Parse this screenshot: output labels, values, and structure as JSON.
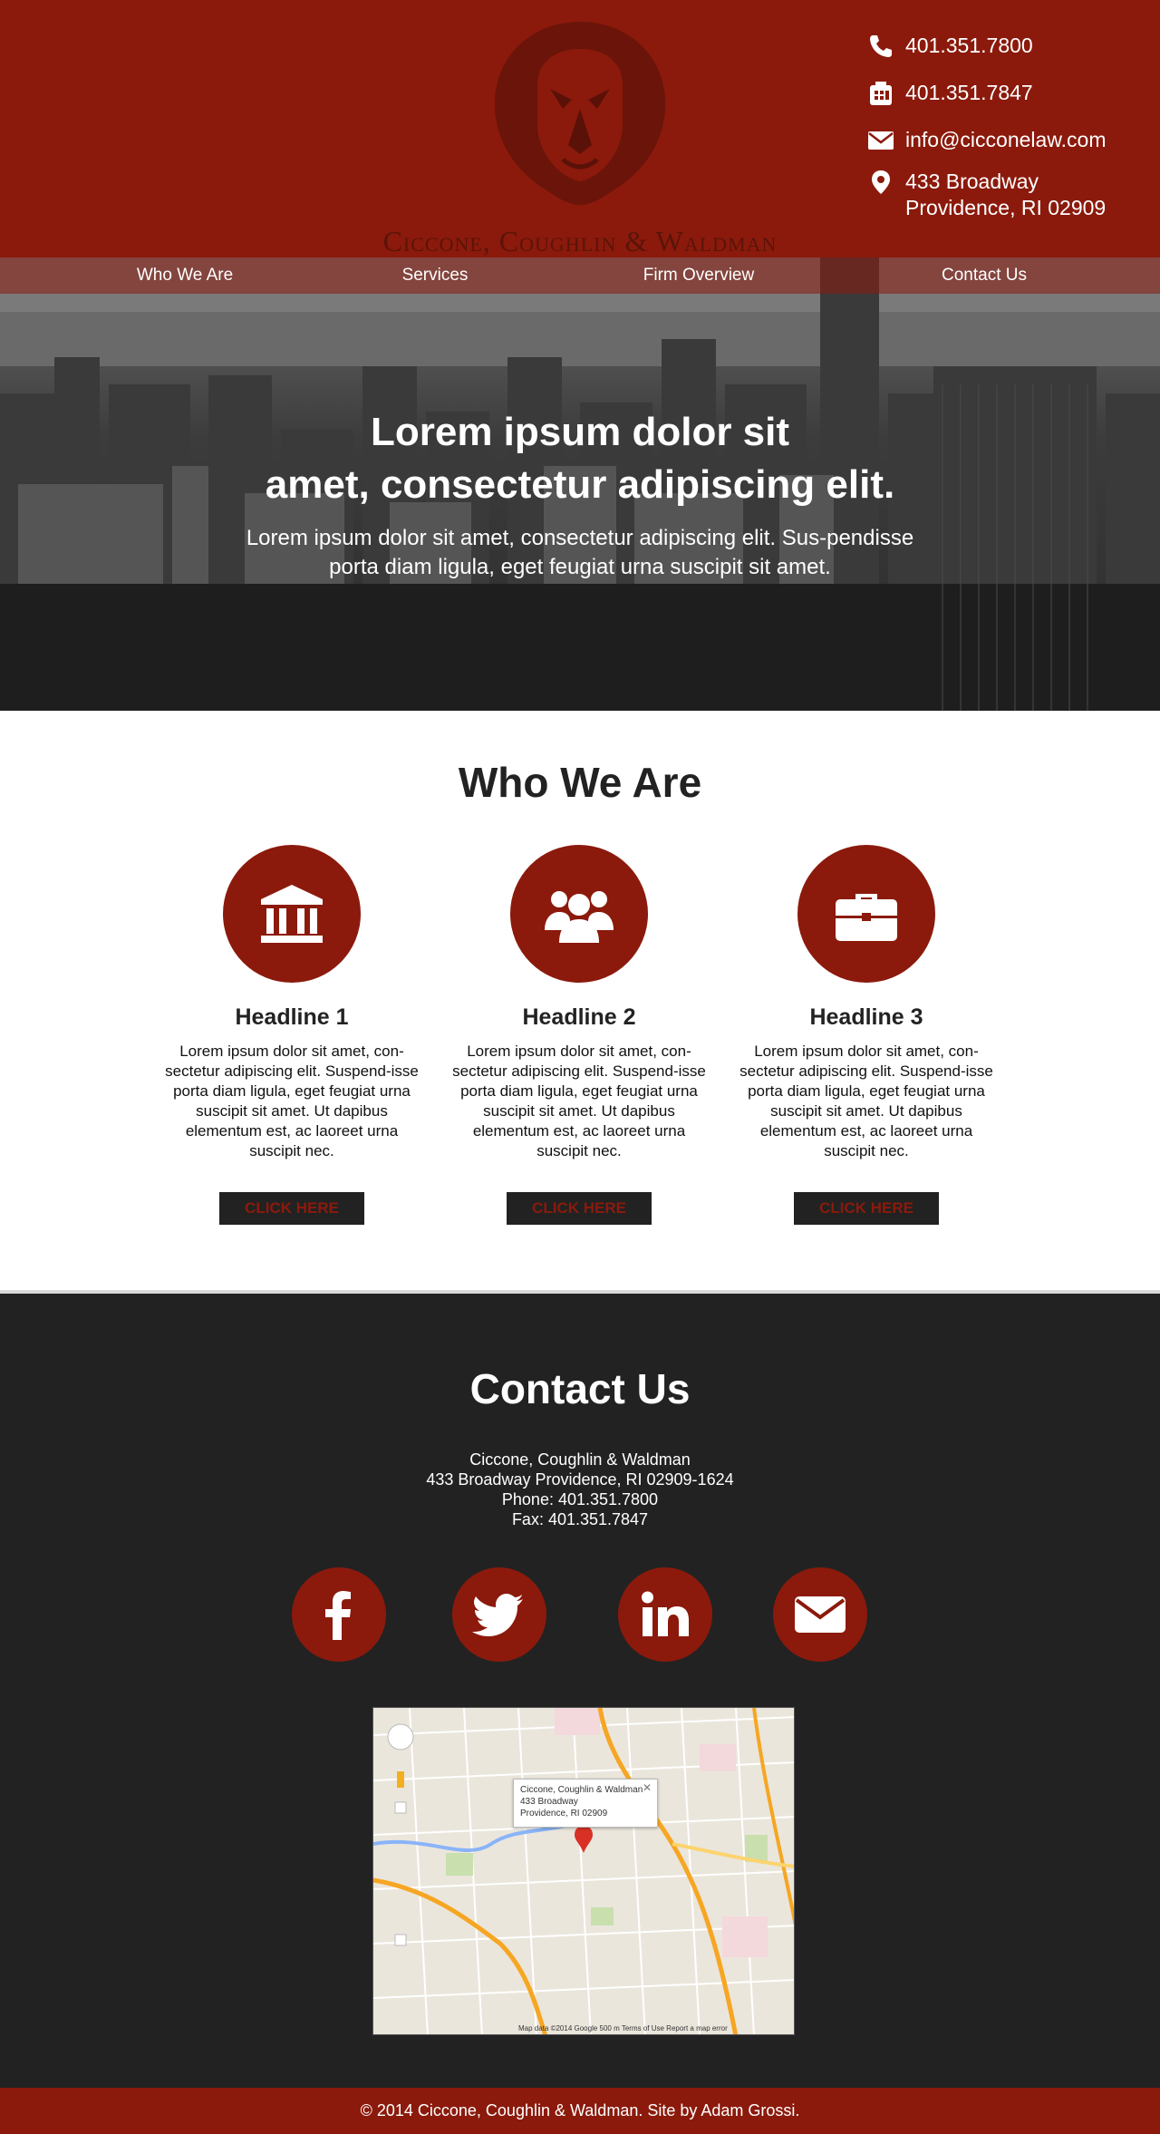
{
  "header": {
    "firm_name": "Ciccone, Coughlin & Waldman",
    "phone": "401.351.7800",
    "fax": "401.351.7847",
    "email": "info@cicconelaw.com",
    "address_line1": "433 Broadway",
    "address_line2": "Providence, RI 02909"
  },
  "nav": {
    "items": [
      {
        "label": "Who We Are"
      },
      {
        "label": "Services"
      },
      {
        "label": "Firm Overview"
      },
      {
        "label": "Contact Us"
      }
    ]
  },
  "hero": {
    "title_line1": "Lorem ipsum dolor sit",
    "title_line2": "amet, consectetur adipiscing elit.",
    "subtitle": "Lorem ipsum dolor sit amet, consectetur adipiscing elit. Sus-pendisse porta diam ligula, eget feugiat urna suscipit sit amet."
  },
  "who_we_are": {
    "title": "Who We Are",
    "features": [
      {
        "headline": "Headline 1",
        "icon": "courthouse-icon",
        "text": "Lorem ipsum dolor sit amet, con-sectetur adipiscing elit. Suspend-isse porta diam ligula, eget feugiat urna suscipit sit amet. Ut dapibus elementum est, ac laoreet urna suscipit nec.",
        "button": "CLICK HERE"
      },
      {
        "headline": "Headline 2",
        "icon": "group-icon",
        "text": "Lorem ipsum dolor sit amet, con-sectetur adipiscing elit. Suspend-isse porta diam ligula, eget feugiat urna suscipit sit amet. Ut dapibus elementum est, ac laoreet urna suscipit nec.",
        "button": "CLICK HERE"
      },
      {
        "headline": "Headline 3",
        "icon": "briefcase-icon",
        "text": "Lorem ipsum dolor sit amet, con-sectetur adipiscing elit. Suspend-isse porta diam ligula, eget feugiat urna suscipit sit amet. Ut dapibus elementum est, ac laoreet urna suscipit nec.",
        "button": "CLICK HERE"
      }
    ]
  },
  "contact": {
    "title": "Contact Us",
    "firm": "Ciccone, Coughlin & Waldman",
    "address": "433 Broadway Providence, RI 02909-1624",
    "phone": "Phone:  401.351.7800",
    "fax": "Fax: 401.351.7847",
    "social": [
      "facebook-icon",
      "twitter-icon",
      "linkedin-icon",
      "mail-icon"
    ]
  },
  "map": {
    "popup_line1": "Ciccone, Coughlin & Waldman",
    "popup_line2": "433 Broadway",
    "popup_line3": "Providence, RI 02909",
    "footer": "Map data ©2014 Google    500 m          Terms of Use    Report a map error"
  },
  "footer": {
    "text": "© 2014 Ciccone, Coughlin & Waldman.  Site by Adam Grossi."
  },
  "colors": {
    "brand_red": "#8b1a0c",
    "dark": "#222222"
  }
}
